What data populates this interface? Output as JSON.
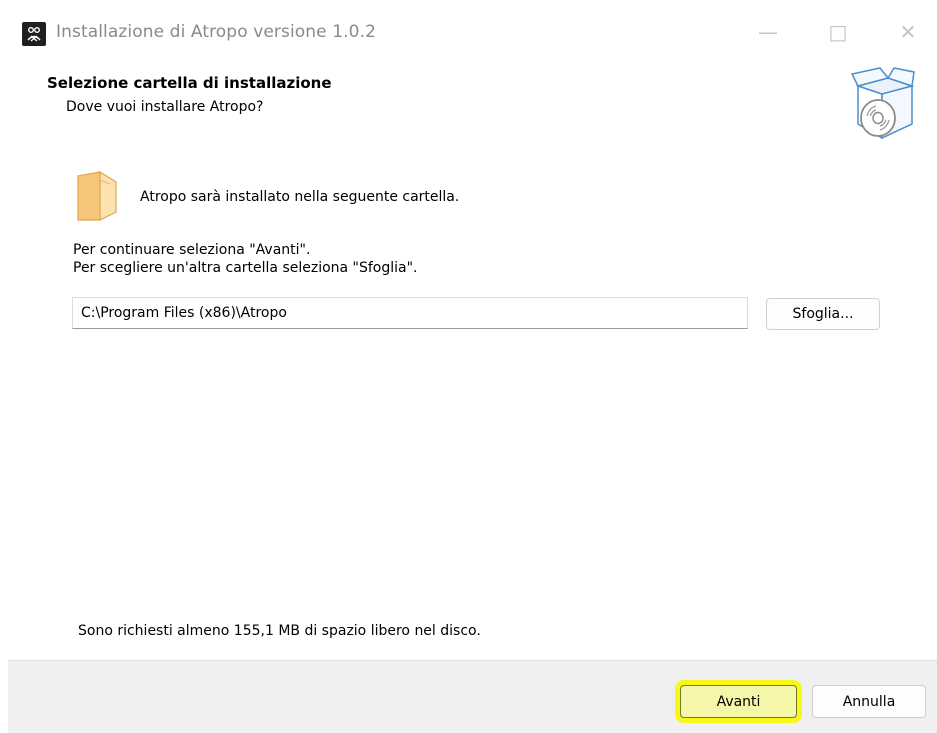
{
  "window": {
    "title": "Installazione di Atropo versione 1.0.2",
    "controls": {
      "minimize": "—",
      "maximize": "□",
      "close": "✕"
    }
  },
  "header": {
    "title": "Selezione cartella di installazione",
    "subtitle": "Dove vuoi installare Atropo?"
  },
  "content": {
    "intro": "Atropo sarà installato nella seguente cartella.",
    "instruction_next": "Per continuare seleziona \"Avanti\".",
    "instruction_browse": "Per scegliere un'altra cartella seleziona \"Sfoglia\".",
    "install_path": "C:\\Program Files (x86)\\Atropo",
    "browse_label": "Sfoglia...",
    "space_required": "Sono richiesti almeno 155,1 MB di spazio libero nel disco."
  },
  "footer": {
    "next_label": "Avanti",
    "cancel_label": "Annulla"
  },
  "colors": {
    "highlight": "#f7f71a",
    "folder": "#f6c77a",
    "footer_bg": "#f0f0f0"
  },
  "icons": {
    "app": "atropo-app-icon",
    "setup": "setup-box-disc-icon",
    "folder": "folder-icon"
  }
}
